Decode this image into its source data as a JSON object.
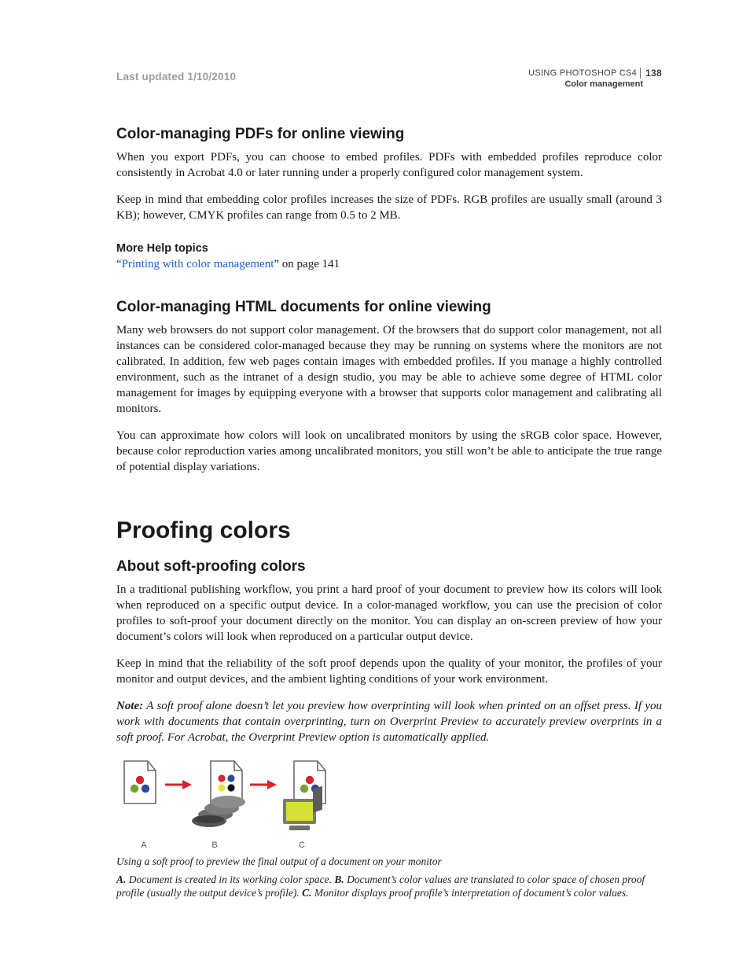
{
  "header": {
    "last_updated": "Last updated 1/10/2010",
    "product": "USING PHOTOSHOP CS4",
    "page_number": "138",
    "section": "Color management"
  },
  "sec_pdf": {
    "heading": "Color-managing PDFs for online viewing",
    "p1": "When you export PDFs, you can choose to embed profiles. PDFs with embedded profiles reproduce color consistently in Acrobat 4.0 or later running under a properly configured color management system.",
    "p2": "Keep in mind that embedding color profiles increases the size of PDFs. RGB profiles are usually small (around 3 KB); however, CMYK profiles can range from 0.5 to 2 MB.",
    "more_help": "More Help topics",
    "ref_quote_open": "“",
    "ref_link": "Printing with color management",
    "ref_tail": "” on page 141"
  },
  "sec_html": {
    "heading": "Color-managing HTML documents for online viewing",
    "p1": "Many web browsers do not support color management. Of the browsers that do support color management, not all instances can be considered color-managed because they may be running on systems where the monitors are not calibrated. In addition, few web pages contain images with embedded profiles. If you manage a highly controlled environment, such as the intranet of a design studio, you may be able to achieve some degree of HTML color management for images by equipping everyone with a browser that supports color management and calibrating all monitors.",
    "p2": "You can approximate how colors will look on uncalibrated monitors by using the sRGB color space. However, because color reproduction varies among uncalibrated monitors, you still won’t be able to anticipate the true range of potential display variations."
  },
  "chapter": {
    "heading": "Proofing colors"
  },
  "sec_soft": {
    "heading": "About soft-proofing colors",
    "p1": "In a traditional publishing workflow, you print a hard proof of your document to preview how its colors will look when reproduced on a specific output device. In a color-managed workflow, you can use the precision of color profiles to soft-proof your document directly on the monitor. You can display an on-screen preview of how your document’s colors will look when reproduced on a particular output device.",
    "p2": "Keep in mind that the reliability of the soft proof depends upon the quality of your monitor, the profiles of your monitor and output devices, and the ambient lighting conditions of your work environment.",
    "note_label": "Note:",
    "note_body": " A soft proof alone doesn’t let you preview how overprinting will look when printed on an offset press. If you work with documents that contain overprinting, turn on Overprint Preview to accurately preview overprints in a soft proof. For Acrobat, the Overprint Preview option is automatically applied."
  },
  "figure": {
    "labels": {
      "a": "A",
      "b": "B",
      "c": "C"
    },
    "caption_main": "Using a soft proof to preview the final output of a document on your monitor",
    "caption_keys": {
      "a_key": "A.",
      "a_txt": " Document is created in its working color space.  ",
      "b_key": "B.",
      "b_txt": " Document’s color values are translated to color space of chosen proof profile (usually the output device’s profile).  ",
      "c_key": "C.",
      "c_txt": " Monitor displays proof profile’s interpretation of document’s color values."
    }
  }
}
